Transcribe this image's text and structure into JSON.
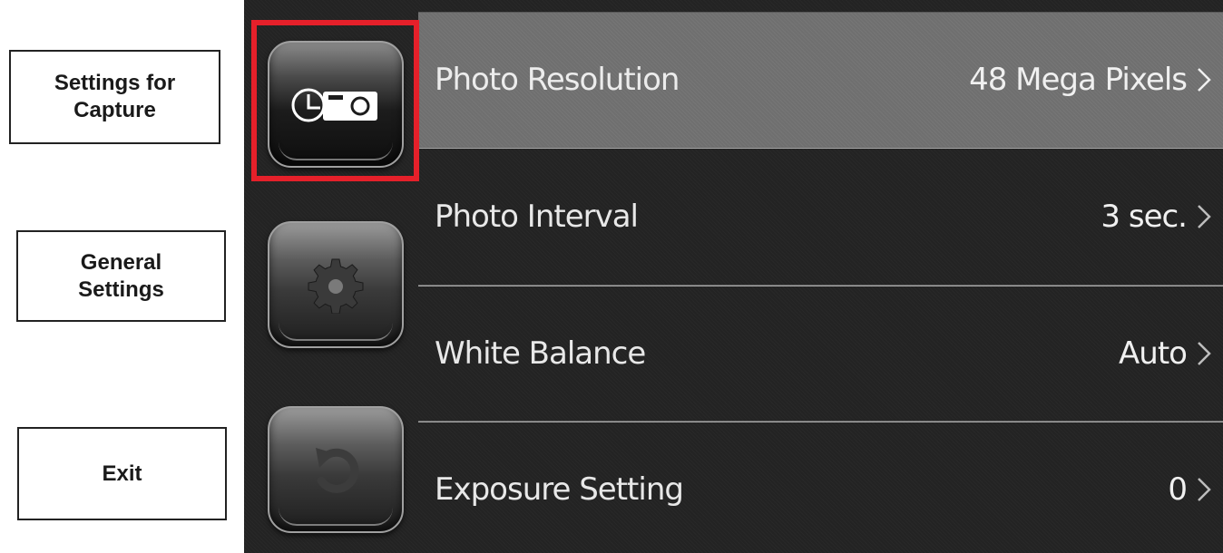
{
  "callouts": {
    "capture": "Settings for\nCapture",
    "general": "General\nSettings",
    "exit": "Exit"
  },
  "tabs": [
    {
      "name": "capture-settings",
      "icon": "timer-camera-icon",
      "selected": true
    },
    {
      "name": "general-settings",
      "icon": "gear-icon",
      "selected": false
    },
    {
      "name": "exit",
      "icon": "back-arrow-icon",
      "selected": false
    }
  ],
  "settings": [
    {
      "label": "Photo Resolution",
      "value": "48 Mega Pixels"
    },
    {
      "label": "Photo Interval",
      "value": "3 sec."
    },
    {
      "label": "White Balance",
      "value": "Auto"
    },
    {
      "label": "Exposure Setting",
      "value": "0"
    }
  ],
  "colors": {
    "highlight": "#e5202a",
    "selected_row": "#6f6f6f",
    "screen_bg": "#232323"
  }
}
